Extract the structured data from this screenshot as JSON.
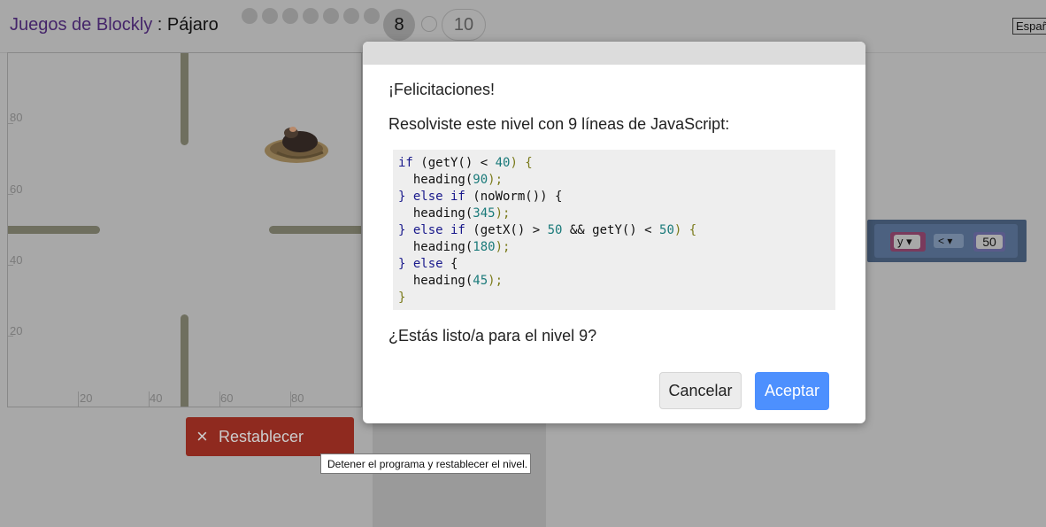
{
  "header": {
    "app_title": "Juegos de Blockly",
    "separator": " : ",
    "level_name": "Pájaro",
    "current_level": "8",
    "last_level": "10",
    "language": "Español"
  },
  "map": {
    "y_labels": [
      "80",
      "60",
      "40",
      "20"
    ],
    "x_labels": [
      "20",
      "40",
      "60",
      "80"
    ]
  },
  "controls": {
    "reset_icon": "×",
    "reset_label": "Restablecer",
    "tooltip": "Detener el programa y restablecer el nivel."
  },
  "workspace": {
    "var_field": "y ▾",
    "op_field": "< ▾",
    "number_field": "50"
  },
  "dialog": {
    "congrats": "¡Felicitaciones!",
    "solved_text": "Resolviste este nivel con 9 líneas de JavaScript:",
    "ready_text": "¿Estás listo/a para el nivel 9?",
    "cancel_label": "Cancelar",
    "accept_label": "Aceptar",
    "code": {
      "l1_kw": "if",
      "l1_a": " (getY() < ",
      "l1_n": "40",
      "l1_b": ") {",
      "l2_a": "  heading(",
      "l2_n": "90",
      "l2_b": ");",
      "l3_kw": "} else if",
      "l3_a": " (noWorm()) {",
      "l4_a": "  heading(",
      "l4_n": "345",
      "l4_b": ");",
      "l5_kw": "} else if",
      "l5_a": " (getX() > ",
      "l5_n1": "50",
      "l5_m": " && getY() < ",
      "l5_n2": "50",
      "l5_b": ") {",
      "l6_a": "  heading(",
      "l6_n": "180",
      "l6_b": ");",
      "l7_kw": "} else",
      "l7_a": " {",
      "l8_a": "  heading(",
      "l8_n": "45",
      "l8_b": ");",
      "l9_a": "}"
    }
  }
}
